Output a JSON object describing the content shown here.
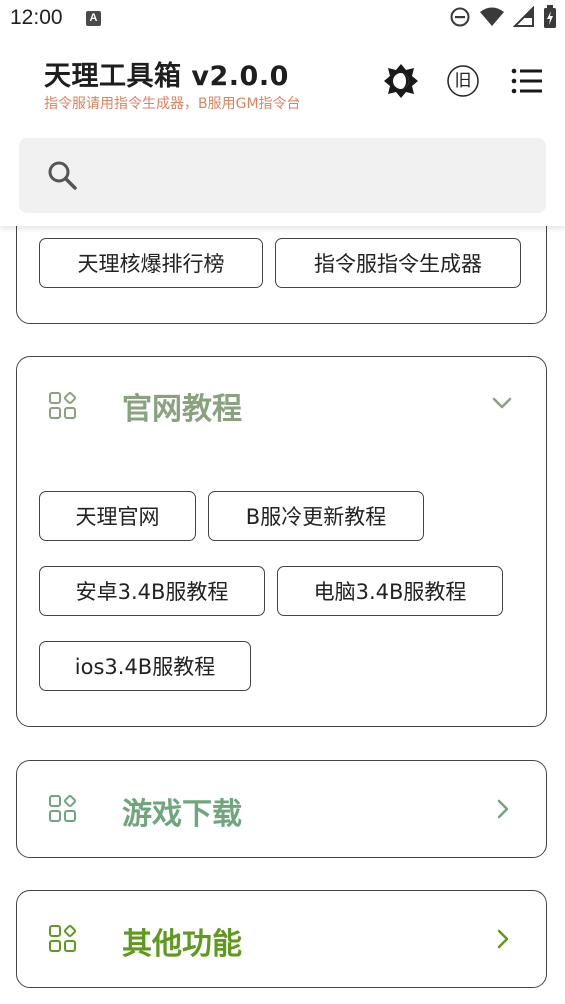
{
  "status_bar": {
    "time": "12:00",
    "notif_letter": "A"
  },
  "app": {
    "title": "天理工具箱 v2.0.0",
    "subtitle": "指令服请用指令生成器，B服用GM指令台",
    "old_badge": "旧",
    "subtitle_color": "#e4815d"
  },
  "search": {
    "placeholder": ""
  },
  "top_card": {
    "buttons": [
      "天理核爆排行榜",
      "指令服指令生成器"
    ]
  },
  "official_card": {
    "title": "官网教程",
    "color": "#8aa37f",
    "buttons": [
      "天理官网",
      "B服冷更新教程",
      "安卓3.4B服教程",
      "电脑3.4B服教程",
      "ios3.4B服教程"
    ]
  },
  "download_card": {
    "title": "游戏下载",
    "color": "#6fa67b"
  },
  "other_card": {
    "title": "其他功能",
    "color": "#5e9a1e"
  }
}
